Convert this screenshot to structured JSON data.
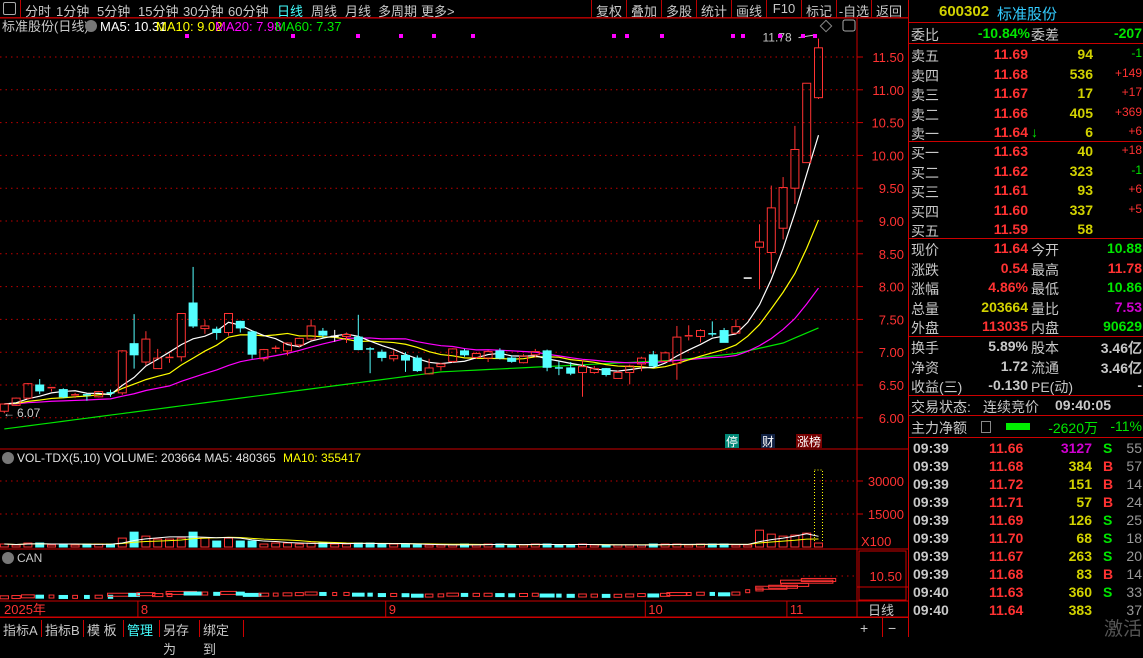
{
  "toolbar": {
    "periods": [
      "分时",
      "1分钟",
      "5分钟",
      "15分钟",
      "30分钟",
      "60分钟",
      "日线",
      "周线",
      "月线",
      "多周期",
      "更多>"
    ],
    "active_period": "日线",
    "buttons": [
      "复权",
      "叠加",
      "多股",
      "统计",
      "画线",
      "F10",
      "标记",
      "-自选",
      "返回"
    ]
  },
  "chart_header": {
    "title": "标准股份(日线)",
    "ma5": "MA5: 10.31",
    "ma10": "MA10: 9.02",
    "ma20": "MA20: 7.98",
    "ma60": "MA60: 7.37"
  },
  "colors": {
    "up": "#ff3232",
    "down": "#54ffff",
    "flat": "#ffffff",
    "ma5": "#ffffff",
    "ma10": "#ffff00",
    "ma20": "#ff00ff",
    "ma60": "#00e600",
    "grid": "#c00000"
  },
  "chart_data": {
    "type": "candlestick",
    "ylim": [
      5.9,
      11.85
    ],
    "y_ticks": [
      "11.50",
      "11.00",
      "10.50",
      "10.00",
      "9.50",
      "9.00",
      "8.50",
      "8.00",
      "7.50",
      "7.00",
      "6.50",
      "6.00"
    ],
    "high_label": "11.78",
    "low_label": "6.07",
    "ohlc": [
      [
        6.1,
        6.21,
        6.07,
        6.21
      ],
      [
        6.19,
        6.31,
        6.18,
        6.3
      ],
      [
        6.3,
        6.53,
        6.28,
        6.52
      ],
      [
        6.5,
        6.59,
        6.36,
        6.41
      ],
      [
        6.44,
        6.47,
        6.4,
        6.46
      ],
      [
        6.43,
        6.45,
        6.3,
        6.32
      ],
      [
        6.33,
        6.38,
        6.3,
        6.35
      ],
      [
        6.35,
        6.37,
        6.26,
        6.33
      ],
      [
        6.32,
        6.41,
        6.31,
        6.4
      ],
      [
        6.38,
        6.43,
        6.32,
        6.37
      ],
      [
        6.38,
        7.03,
        6.35,
        7.02
      ],
      [
        7.13,
        7.58,
        6.75,
        6.96
      ],
      [
        6.85,
        7.32,
        6.8,
        7.2
      ],
      [
        6.75,
        7.05,
        6.75,
        6.91
      ],
      [
        6.9,
        6.98,
        6.84,
        6.92
      ],
      [
        6.93,
        7.59,
        6.86,
        7.59
      ],
      [
        7.75,
        8.3,
        7.37,
        7.4
      ],
      [
        7.36,
        7.49,
        7.28,
        7.4
      ],
      [
        7.35,
        7.39,
        7.19,
        7.3
      ],
      [
        7.3,
        7.59,
        7.25,
        7.59
      ],
      [
        7.47,
        7.48,
        7.3,
        7.37
      ],
      [
        7.31,
        7.33,
        6.9,
        6.97
      ],
      [
        6.9,
        7.05,
        6.86,
        7.04
      ],
      [
        7.04,
        7.1,
        7.0,
        7.06
      ],
      [
        7.02,
        7.15,
        6.95,
        7.14
      ],
      [
        7.11,
        7.22,
        7.08,
        7.21
      ],
      [
        7.2,
        7.5,
        7.18,
        7.4
      ],
      [
        7.32,
        7.37,
        7.22,
        7.26
      ],
      [
        7.24,
        7.34,
        7.16,
        7.24
      ],
      [
        7.24,
        7.3,
        7.14,
        7.27
      ],
      [
        7.23,
        7.57,
        7.03,
        7.04
      ],
      [
        7.05,
        7.08,
        6.68,
        7.04
      ],
      [
        7.0,
        7.04,
        6.86,
        6.92
      ],
      [
        6.9,
        7.03,
        6.86,
        6.95
      ],
      [
        6.95,
        7.0,
        6.7,
        6.88
      ],
      [
        6.91,
        6.95,
        6.7,
        6.72
      ],
      [
        6.67,
        6.9,
        6.66,
        6.76
      ],
      [
        6.78,
        6.84,
        6.72,
        6.82
      ],
      [
        6.86,
        7.06,
        6.84,
        7.05
      ],
      [
        7.02,
        7.05,
        6.93,
        6.96
      ],
      [
        6.92,
        7.0,
        6.9,
        6.98
      ],
      [
        6.91,
        7.03,
        6.85,
        7.01
      ],
      [
        7.02,
        7.06,
        6.89,
        6.91
      ],
      [
        6.91,
        6.95,
        6.84,
        6.86
      ],
      [
        6.84,
        6.97,
        6.83,
        6.94
      ],
      [
        6.96,
        7.05,
        6.92,
        7.01
      ],
      [
        7.02,
        7.04,
        6.71,
        6.77
      ],
      [
        6.76,
        6.86,
        6.65,
        6.75
      ],
      [
        6.76,
        6.85,
        6.65,
        6.68
      ],
      [
        6.69,
        6.88,
        6.32,
        6.78
      ],
      [
        6.69,
        6.79,
        6.67,
        6.75
      ],
      [
        6.75,
        6.76,
        6.63,
        6.66
      ],
      [
        6.6,
        6.72,
        6.6,
        6.69
      ],
      [
        6.69,
        6.81,
        6.51,
        6.79
      ],
      [
        6.82,
        6.93,
        6.71,
        6.91
      ],
      [
        6.96,
        7.02,
        6.77,
        6.79
      ],
      [
        6.86,
        7.01,
        6.84,
        6.99
      ],
      [
        6.83,
        7.4,
        6.58,
        7.23
      ],
      [
        7.23,
        7.41,
        7.18,
        7.25
      ],
      [
        7.24,
        7.35,
        7.15,
        7.33
      ],
      [
        7.28,
        7.47,
        7.24,
        7.27
      ],
      [
        7.33,
        7.37,
        7.15,
        7.15
      ],
      [
        7.29,
        7.5,
        7.28,
        7.39
      ],
      [
        8.13,
        8.13,
        8.13,
        8.13
      ],
      [
        8.6,
        8.95,
        7.96,
        8.68
      ],
      [
        8.52,
        9.54,
        8.2,
        9.2
      ],
      [
        8.89,
        9.67,
        8.72,
        9.51
      ],
      [
        9.5,
        10.45,
        9.26,
        10.09
      ],
      [
        9.89,
        11.1,
        9.89,
        11.1
      ],
      [
        10.88,
        11.78,
        10.86,
        11.64
      ]
    ],
    "ma60_points": [
      [
        0,
        5.83
      ],
      [
        20,
        6.3
      ],
      [
        37,
        6.7
      ],
      [
        57,
        6.88
      ],
      [
        62,
        6.98
      ],
      [
        66,
        7.14
      ],
      [
        69,
        7.37
      ]
    ],
    "volume": [
      1350,
      900,
      1800,
      1800,
      900,
      1350,
      900,
      1350,
      1350,
      1350,
      4050,
      6750,
      4950,
      3600,
      3600,
      4050,
      6750,
      4050,
      2700,
      4050,
      2700,
      2700,
      1350,
      1800,
      1800,
      1350,
      1800,
      1800,
      1350,
      1350,
      1800,
      1800,
      1350,
      1350,
      1350,
      900,
      900,
      900,
      900,
      1350,
      900,
      1350,
      1350,
      900,
      900,
      1350,
      1350,
      900,
      900,
      1350,
      900,
      900,
      900,
      900,
      900,
      1350,
      1350,
      1350,
      900,
      1350,
      1350,
      1350,
      900,
      900,
      7650,
      5850,
      4950,
      5400,
      6300,
      1800
    ],
    "volume_estimate_last": 35000,
    "volume_ylim": [
      0,
      40000
    ],
    "volume_ticks": [
      "30000",
      "15000"
    ],
    "volume_unit": "X100",
    "can_tick": "10.50",
    "date_labels": [
      {
        "i": 0,
        "text": "2025年"
      },
      {
        "i": 12,
        "text": "8"
      },
      {
        "i": 33,
        "text": "9"
      },
      {
        "i": 55,
        "text": "10"
      },
      {
        "i": 67,
        "text": "11"
      }
    ],
    "period_label": "日线"
  },
  "volume_header": {
    "text": "VOL-TDX(5,10) VOLUME: 203664 MA5: 480365",
    "ma10": "MA10: 355417"
  },
  "can_header": {
    "text": "CAN"
  },
  "flags": {
    "halt": "停",
    "finance": "财",
    "limit_list": "涨榜"
  },
  "bottom_tabs": [
    "指标A",
    "指标B",
    "模 板",
    "管理",
    "另存为",
    "绑定到"
  ],
  "bottom_active": "管理",
  "zoom": {
    "plus": "+",
    "minus": "−"
  },
  "quote": {
    "code": "600302",
    "name": "标准股份",
    "weibi_label": "委比",
    "weibi": "-10.84%",
    "weicha_label": "委差",
    "weicha": "-207",
    "sells": [
      {
        "label": "卖五",
        "price": "11.69",
        "vol": "94",
        "chg": "-1"
      },
      {
        "label": "卖四",
        "price": "11.68",
        "vol": "536",
        "chg": "+149"
      },
      {
        "label": "卖三",
        "price": "11.67",
        "vol": "17",
        "chg": "+17"
      },
      {
        "label": "卖二",
        "price": "11.66",
        "vol": "405",
        "chg": "+369"
      },
      {
        "label": "卖一",
        "price": "11.64",
        "vol": "6",
        "chg": "+6"
      }
    ],
    "buys": [
      {
        "label": "买一",
        "price": "11.63",
        "vol": "40",
        "chg": "+18"
      },
      {
        "label": "买二",
        "price": "11.62",
        "vol": "323",
        "chg": "-1"
      },
      {
        "label": "买三",
        "price": "11.61",
        "vol": "93",
        "chg": "+6"
      },
      {
        "label": "买四",
        "price": "11.60",
        "vol": "337",
        "chg": "+5"
      },
      {
        "label": "买五",
        "price": "11.59",
        "vol": "58",
        "chg": ""
      }
    ],
    "stats": [
      {
        "l1": "现价",
        "v1": "11.64",
        "c1": "r",
        "l2": "今开",
        "v2": "10.88",
        "c2": "g"
      },
      {
        "l1": "涨跌",
        "v1": "0.54",
        "c1": "r",
        "l2": "最高",
        "v2": "11.78",
        "c2": "r"
      },
      {
        "l1": "涨幅",
        "v1": "4.86%",
        "c1": "r",
        "l2": "最低",
        "v2": "10.86",
        "c2": "g"
      },
      {
        "l1": "总量",
        "v1": "203664",
        "c1": "y",
        "l2": "量比",
        "v2": "7.53",
        "c2": "m"
      },
      {
        "l1": "外盘",
        "v1": "113035",
        "c1": "r",
        "l2": "内盘",
        "v2": "90629",
        "c2": "g"
      }
    ],
    "fin": [
      {
        "l1": "换手",
        "v1": "5.89%",
        "l2": "股本",
        "v2": "3.46亿"
      },
      {
        "l1": "净资",
        "v1": "1.72",
        "l2": "流通",
        "v2": "3.46亿"
      },
      {
        "l1": "收益(三)",
        "v1": "-0.130",
        "l2": "PE(动)",
        "v2": "-"
      }
    ],
    "status_label": "交易状态:",
    "status": "连续竞价",
    "status_time": "09:40:05",
    "main_label": "主力净额",
    "main_value": "-2620万",
    "main_pct": "-11%"
  },
  "ticks": [
    [
      "09:39",
      "11.66",
      "3127",
      "S",
      "55"
    ],
    [
      "09:39",
      "11.68",
      "384",
      "B",
      "57"
    ],
    [
      "09:39",
      "11.72",
      "151",
      "B",
      "14"
    ],
    [
      "09:39",
      "11.71",
      "57",
      "B",
      "24"
    ],
    [
      "09:39",
      "11.69",
      "126",
      "S",
      "25"
    ],
    [
      "09:39",
      "11.70",
      "68",
      "S",
      "18"
    ],
    [
      "09:39",
      "11.67",
      "263",
      "S",
      "20"
    ],
    [
      "09:39",
      "11.68",
      "83",
      "B",
      "14"
    ],
    [
      "09:40",
      "11.63",
      "360",
      "S",
      "33"
    ],
    [
      "09:40",
      "11.64",
      "383",
      "",
      "37"
    ]
  ],
  "watermark": "激活"
}
